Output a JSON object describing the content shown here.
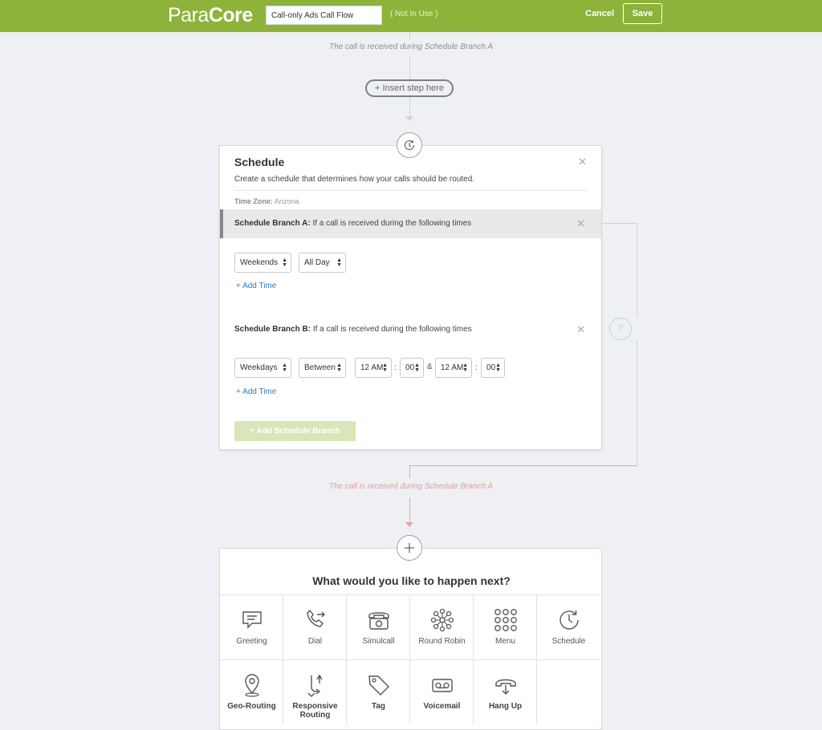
{
  "header": {
    "logo_para": "Para",
    "logo_core": "Core",
    "flow_name": "Call-only Ads Call Flow",
    "status": "( Not In Use )",
    "cancel_label": "Cancel",
    "save_label": "Save"
  },
  "flow": {
    "caption_top": "The call is received during Schedule Branch A",
    "insert_step_label": "+ Insert step here",
    "caption_bottom": "The call is received during Schedule Branch A",
    "question_mark": "?"
  },
  "schedule": {
    "title": "Schedule",
    "description": "Create a schedule that determines how your calls should be routed.",
    "timezone_label": "Time Zone:",
    "timezone_value": "Arizona",
    "branch_a": {
      "name": "Schedule Branch A:",
      "condition": "If a call is received during the following times",
      "day": "Weekends",
      "time": "All Day",
      "add_time": "+ Add Time"
    },
    "branch_b": {
      "name": "Schedule Branch B:",
      "condition": "If a call is received during the following times",
      "day": "Weekdays",
      "mode": "Between",
      "start_hour": "12 AM",
      "start_min": "00",
      "amp": "&",
      "end_hour": "12 AM",
      "end_min": "00",
      "add_time": "+ Add Time"
    },
    "add_branch_label": "+   Add Schedule Branch"
  },
  "next_step": {
    "title": "What would you like to happen next?",
    "options": [
      {
        "label": "Greeting",
        "icon": "speech-bubble-icon"
      },
      {
        "label": "Dial",
        "icon": "phone-forward-icon"
      },
      {
        "label": "Simulcall",
        "icon": "telephone-icon"
      },
      {
        "label": "Round Robin",
        "icon": "network-icon"
      },
      {
        "label": "Menu",
        "icon": "keypad-icon"
      },
      {
        "label": "Schedule",
        "icon": "clock-icon"
      },
      {
        "label": "Geo-Routing",
        "icon": "map-pin-icon"
      },
      {
        "label": "Responsive Routing",
        "icon": "split-arrow-icon"
      },
      {
        "label": "Tag",
        "icon": "tag-icon"
      },
      {
        "label": "Voicemail",
        "icon": "voicemail-icon"
      },
      {
        "label": "Hang Up",
        "icon": "hang-up-icon"
      }
    ]
  }
}
